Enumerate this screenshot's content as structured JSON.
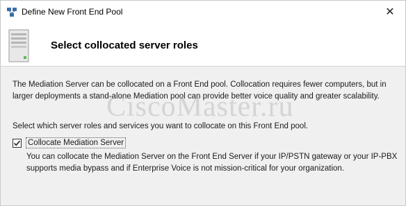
{
  "window": {
    "title": "Define New Front End Pool",
    "close_glyph": "✕"
  },
  "header": {
    "title": "Select collocated server roles",
    "icon": "server-icon"
  },
  "content": {
    "intro": "The Mediation Server can be collocated on a Front End pool. Collocation requires fewer computers, but in larger deployments a stand-alone Mediation pool can provide better voice quality and greater scalability.",
    "instruction": "Select which server roles and services you want to collocate on this Front End pool.",
    "options": [
      {
        "label": "Collocate Mediation Server",
        "checked": true,
        "description": "You can collocate the Mediation Server on the Front End Server if your IP/PSTN gateway or your IP-PBX supports media bypass and if Enterprise Voice is not mission-critical for your organization."
      }
    ]
  },
  "watermark": "CiscoMaster.ru"
}
